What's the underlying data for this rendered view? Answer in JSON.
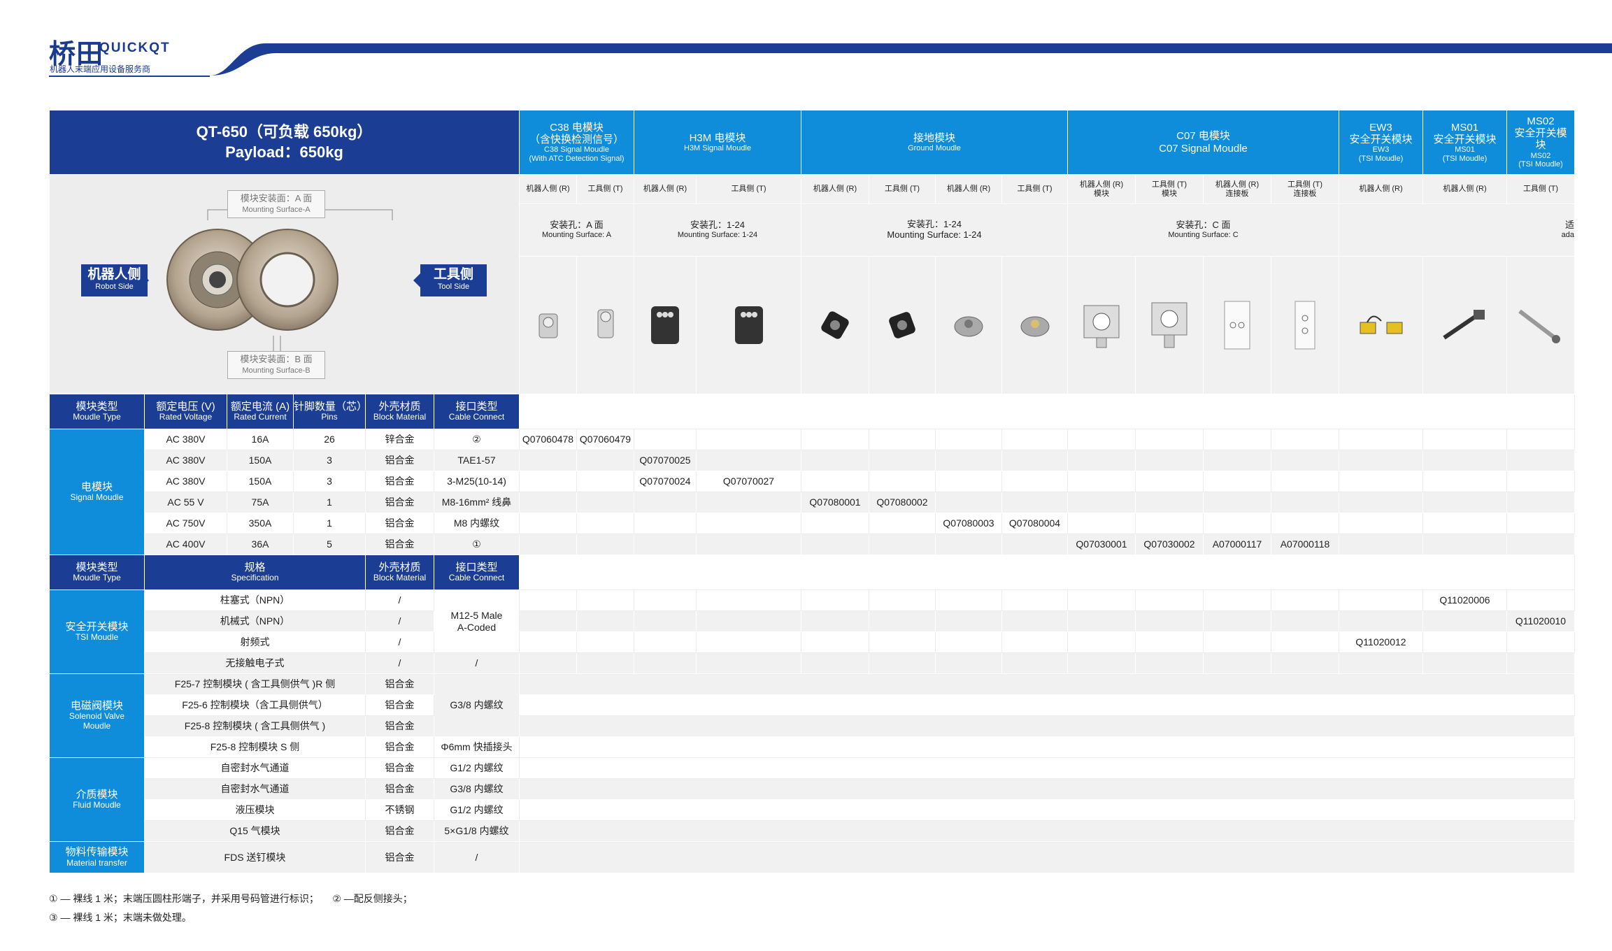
{
  "brand": {
    "name_cn": "桥田",
    "name_en": "QUICKQT",
    "tagline": "机器人末端应用设备服务商",
    "accent": "#1b3d93",
    "blue": "#0f8ddb"
  },
  "title": {
    "line1": "QT-650（可负载 650kg）",
    "line2": "Payload：650kg"
  },
  "figure": {
    "mount_a_cn": "模块安装面：A 面",
    "mount_a_en": "Mounting Surface-A",
    "mount_b_cn": "模块安装面：B 面",
    "mount_b_en": "Mounting Surface-B",
    "robot_cn": "机器人侧",
    "robot_en": "Robot Side",
    "tool_cn": "工具侧",
    "tool_en": "Tool Side"
  },
  "modules": [
    {
      "cn": "C38 电模块",
      "cn2": "（含快换检测信号）",
      "en": "C38 Signal Moudle",
      "en2": "(With ATC Detection Signal)"
    },
    {
      "cn": "H3M 电模块",
      "en": "H3M Signal Moudle"
    },
    {
      "cn": "接地模块",
      "en": "Ground Moudle"
    },
    {
      "cn": "C07 电模块",
      "en": "C07 Signal Moudle"
    },
    {
      "cn": "EW3",
      "cn2": "安全开关模块",
      "en": "EW3",
      "en2": "(TSI Moudle)"
    },
    {
      "cn": "MS01",
      "cn2": "安全开关模块",
      "en": "MS01",
      "en2": "(TSI Moudle)"
    },
    {
      "cn": "MS02",
      "cn2": "安全开关模",
      "cn3": "块",
      "en": "MS02",
      "en2": "(TSI Moudle)"
    }
  ],
  "sides": [
    {
      "t": "机器人侧 (R)"
    },
    {
      "t": "工具侧 (T)"
    },
    {
      "t": "机器人侧 (R)"
    },
    {
      "t": "工具侧 (T)"
    },
    {
      "t": "机器人侧 (R)"
    },
    {
      "t": "工具侧 (T)"
    },
    {
      "t": "机器人侧 (R)"
    },
    {
      "t": "工具侧 (T)"
    },
    {
      "t": "机器人侧 (R)",
      "s": "模块"
    },
    {
      "t": "工具侧 (T)",
      "s": "模块"
    },
    {
      "t": "机器人侧 (R)",
      "s": "连接板"
    },
    {
      "t": "工具侧 (T)",
      "s": "连接板"
    },
    {
      "t": "机器人侧 (R)"
    },
    {
      "t": "机器人侧 (R)"
    },
    {
      "t": "工具侧 (T)"
    }
  ],
  "mounting": [
    {
      "cn": "安装孔：A 面",
      "en": "Mounting Surface: A"
    },
    {
      "cn": "安装孔：1-24",
      "en": "Mounting Surface: 1-24"
    },
    {
      "cn": "安装孔：1-24",
      "en": "Mounting Surface: 1-24"
    },
    {
      "cn": "安装孔：C 面",
      "en": "Mounting Surface: C"
    },
    {
      "cn": "适",
      "en": "ada"
    }
  ],
  "signal_header": [
    {
      "cn": "模块类型",
      "en": "Moudle Type"
    },
    {
      "cn": "额定电压 (V)",
      "en": "Rated Voltage"
    },
    {
      "cn": "额定电流 (A)",
      "en": "Rated Current"
    },
    {
      "cn": "针脚数量（芯）",
      "en": "Pins"
    },
    {
      "cn": "外壳材质",
      "en": "Block Material"
    },
    {
      "cn": "接口类型",
      "en": "Cable Connect"
    }
  ],
  "signal_group": {
    "cn": "电模块",
    "en": "Signal Moudle"
  },
  "signal_rows": [
    {
      "v": "AC 380V",
      "a": "16A",
      "p": "26",
      "m": "锌合金",
      "c": "②",
      "codes": [
        "Q07060478",
        "Q07060479",
        "",
        "",
        "",
        "",
        "",
        "",
        "",
        "",
        "",
        "",
        "",
        "",
        ""
      ]
    },
    {
      "v": "AC 380V",
      "a": "150A",
      "p": "3",
      "m": "铝合金",
      "c": "TAE1-57",
      "codes": [
        "",
        "",
        "Q07070025",
        "",
        "",
        "",
        "",
        "",
        "",
        "",
        "",
        "",
        "",
        "",
        ""
      ]
    },
    {
      "v": "AC 380V",
      "a": "150A",
      "p": "3",
      "m": "铝合金",
      "c": "3-M25(10-14)",
      "codes": [
        "",
        "",
        "Q07070024",
        "Q07070027",
        "",
        "",
        "",
        "",
        "",
        "",
        "",
        "",
        "",
        "",
        ""
      ]
    },
    {
      "v": "AC 55 V",
      "a": "75A",
      "p": "1",
      "m": "铝合金",
      "c": "M8-16mm² 线鼻",
      "codes": [
        "",
        "",
        "",
        "",
        "Q07080001",
        "Q07080002",
        "",
        "",
        "",
        "",
        "",
        "",
        "",
        "",
        ""
      ]
    },
    {
      "v": "AC 750V",
      "a": "350A",
      "p": "1",
      "m": "铝合金",
      "c": "M8 内螺纹",
      "codes": [
        "",
        "",
        "",
        "",
        "",
        "",
        "Q07080003",
        "Q07080004",
        "",
        "",
        "",
        "",
        "",
        "",
        ""
      ]
    },
    {
      "v": "AC 400V",
      "a": "36A",
      "p": "5",
      "m": "铝合金",
      "c": "①",
      "codes": [
        "",
        "",
        "",
        "",
        "",
        "",
        "",
        "",
        "Q07030001",
        "Q07030002",
        "A07000117",
        "A07000118",
        "",
        "",
        ""
      ]
    }
  ],
  "other_header": [
    {
      "cn": "模块类型",
      "en": "Moudle Type"
    },
    {
      "cn": "规格",
      "en": "Specification"
    },
    {
      "cn": "外壳材质",
      "en": "Block Material"
    },
    {
      "cn": "接口类型",
      "en": "Cable Connect"
    }
  ],
  "tsi": {
    "cn": "安全开关模块",
    "en": "TSI Moudle",
    "conn1": "M12-5 Male",
    "conn2": "A-Coded",
    "rows": [
      {
        "s": "柱塞式（NPN）",
        "m": "/",
        "codes": [
          "",
          "",
          "",
          "",
          "",
          "",
          "",
          "",
          "",
          "",
          "",
          "",
          "",
          "Q11020006",
          ""
        ]
      },
      {
        "s": "机械式（NPN）",
        "m": "/",
        "codes": [
          "",
          "",
          "",
          "",
          "",
          "",
          "",
          "",
          "",
          "",
          "",
          "",
          "",
          "",
          "Q11020010"
        ]
      },
      {
        "s": "射频式",
        "m": "/",
        "codes": [
          "",
          "",
          "",
          "",
          "",
          "",
          "",
          "",
          "",
          "",
          "",
          "",
          "Q11020012",
          "",
          ""
        ]
      },
      {
        "s": "无接触电子式",
        "m": "/",
        "c": "/",
        "codes": [
          "",
          "",
          "",
          "",
          "",
          "",
          "",
          "",
          "",
          "",
          "",
          "",
          "",
          "",
          ""
        ]
      }
    ]
  },
  "sv": {
    "cn": "电磁阀模块",
    "en1": "Solenoid Valve",
    "en2": "Moudle",
    "conn": "G3/8 内螺纹",
    "rows": [
      {
        "s": "F25-7 控制模块 ( 含工具侧供气 )R 侧",
        "m": "铝合金"
      },
      {
        "s": "F25-6 控制模块（含工具侧供气）",
        "m": "铝合金"
      },
      {
        "s": "F25-8 控制模块 ( 含工具侧供气 )",
        "m": "铝合金"
      },
      {
        "s": "F25-8 控制模块 S 侧",
        "m": "铝合金",
        "c": "Φ6mm 快插接头"
      }
    ]
  },
  "fluid": {
    "cn": "介质模块",
    "en": "Fluid Moudle",
    "rows": [
      {
        "s": "自密封水气通道",
        "m": "铝合金",
        "c": "G1/2 内螺纹"
      },
      {
        "s": "自密封水气通道",
        "m": "铝合金",
        "c": "G3/8 内螺纹"
      },
      {
        "s": "液压模块",
        "m": "不锈钢",
        "c": "G1/2 内螺纹"
      },
      {
        "s": "Q15 气模块",
        "m": "铝合金",
        "c": "5×G1/8 内螺纹"
      }
    ]
  },
  "mt": {
    "cn": "物料传输模块",
    "en": "Material transfer",
    "s": "FDS 送钉模块",
    "m": "铝合金",
    "c": "/"
  },
  "notes": {
    "n1": "① — 裸线 1 米；末端压圆柱形端子，并采用号码管进行标识；",
    "n2": "② —配反侧接头；",
    "n3": "③ — 裸线 1 米；末端未做处理。"
  }
}
